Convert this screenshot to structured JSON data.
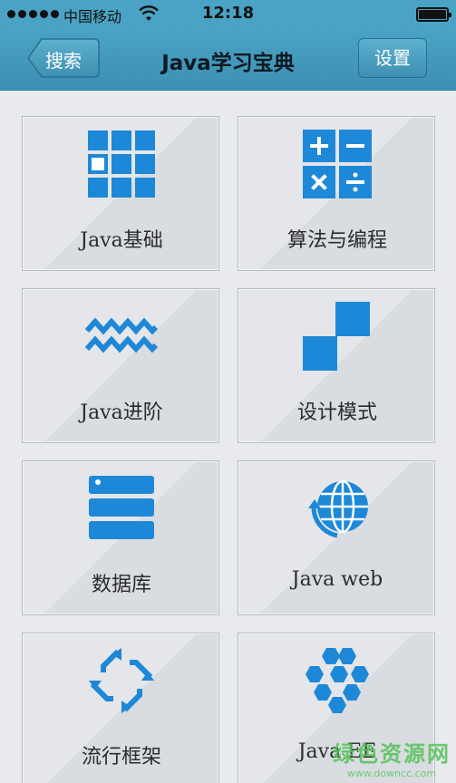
{
  "statusbar": {
    "carrier": "中国移动",
    "time": "12:18"
  },
  "navbar": {
    "back_label": "搜索",
    "title": "Java学习宝典",
    "settings_label": "设置"
  },
  "tiles": [
    {
      "label": "Java基础",
      "icon": "grid-icon"
    },
    {
      "label": "算法与编程",
      "icon": "calculator-icon"
    },
    {
      "label": "Java进阶",
      "icon": "waves-icon"
    },
    {
      "label": "设计模式",
      "icon": "pattern-icon"
    },
    {
      "label": "数据库",
      "icon": "database-icon"
    },
    {
      "label": "Java web",
      "icon": "globe-icon"
    },
    {
      "label": "流行框架",
      "icon": "cycle-arrows-icon"
    },
    {
      "label": "Java EE",
      "icon": "hexagons-icon"
    }
  ],
  "watermark": {
    "line1": "绿色资源网",
    "line2": "www.downcc.com"
  },
  "colors": {
    "navbar": "#4aa3c4",
    "icon_blue": "#1e88d8",
    "background": "#e8eaed"
  }
}
